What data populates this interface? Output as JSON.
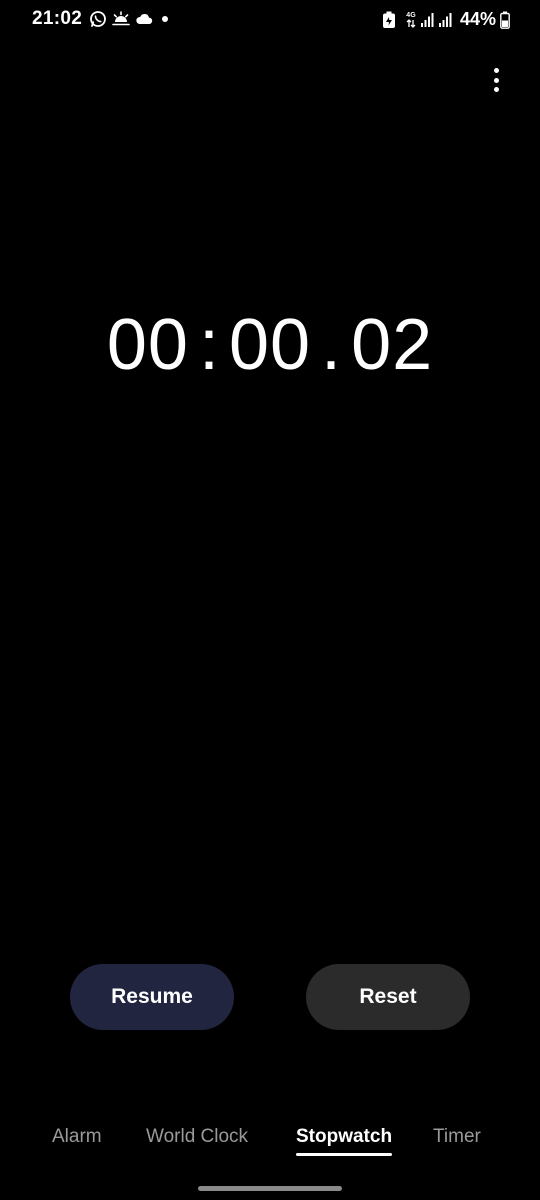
{
  "status_bar": {
    "time": "21:02",
    "network": "4G",
    "battery_percent": "44%",
    "left_icons": [
      "whatsapp-icon",
      "weather-sunrise-icon",
      "cloud-icon",
      "notification-dot-icon"
    ],
    "right_icons": [
      "battery-saver-icon",
      "network-4g-icon",
      "signal-icon",
      "signal-icon",
      "battery-icon"
    ]
  },
  "menu": {
    "icon": "more-vertical-icon"
  },
  "stopwatch": {
    "minutes": "00",
    "seconds": "00",
    "hundredths": "02",
    "sep1": ":",
    "sep2": "."
  },
  "buttons": {
    "resume_label": "Resume",
    "reset_label": "Reset",
    "resume_color": "#22253f",
    "reset_color": "#2b2b2b"
  },
  "tabs": [
    {
      "label": "Alarm",
      "active": false
    },
    {
      "label": "World Clock",
      "active": false
    },
    {
      "label": "Stopwatch",
      "active": true
    },
    {
      "label": "Timer",
      "active": false
    }
  ]
}
